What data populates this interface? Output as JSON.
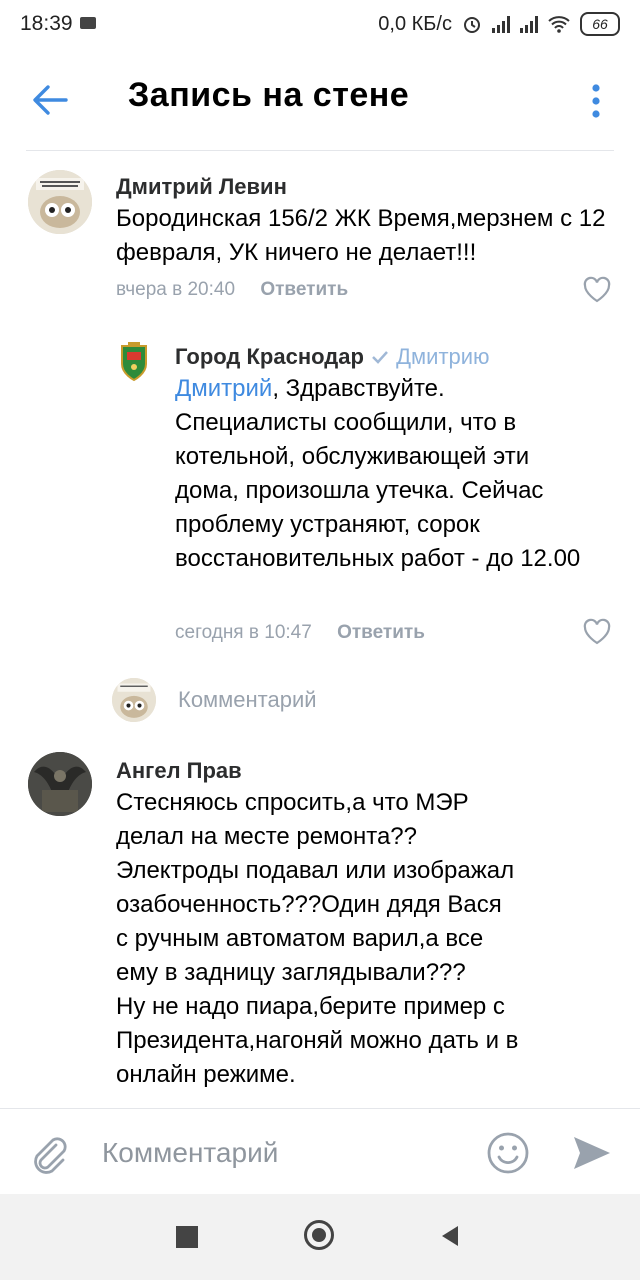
{
  "status_bar": {
    "time": "18:39",
    "network_speed": "0,0 КБ/с",
    "battery": "66"
  },
  "header": {
    "title": "Запись на стене",
    "back_icon": "arrow-left-icon",
    "more_icon": "more-vertical-icon"
  },
  "comments": [
    {
      "author": "Дмитрий Левин",
      "text": "Бородинская 156/2 ЖК Время,мерзнем с 12 февраля, УК ничего не делает!!!",
      "time": "вчера в 20:40",
      "reply_label": "Ответить"
    },
    {
      "author": "Город Краснодар",
      "verified": true,
      "reply_to": "Дмитрию",
      "mention": "Дмитрий",
      "text": ", Здравствуйте. Специалисты сообщили, что в котельной, обслуживающей эти дома, произошла утечка. Сейчас проблему устраняют, сорок восстановительных работ - до 12.00",
      "time": "сегодня в 10:47",
      "reply_label": "Ответить"
    },
    {
      "author": "Ангел Прав",
      "text_lines": [
        "Стесняюсь спросить,а что МЭР",
        "делал на месте ремонта??",
        "Электроды подавал или изображал",
        "озабоченность???Один дядя Вася",
        "с ручным автоматом варил,а все",
        "ему в задницу заглядывали???",
        "Ну не надо пиара,берите пример с",
        "Президента,нагоняй можно дать и в",
        "онлайн режиме."
      ]
    }
  ],
  "reply_placeholder": "Комментарий",
  "input_bar": {
    "placeholder": "Комментарий",
    "attach_icon": "paperclip-icon",
    "emoji_icon": "smile-icon",
    "send_icon": "send-icon"
  },
  "colors": {
    "accent": "#3f8ae0",
    "meta": "#99a2ad"
  }
}
